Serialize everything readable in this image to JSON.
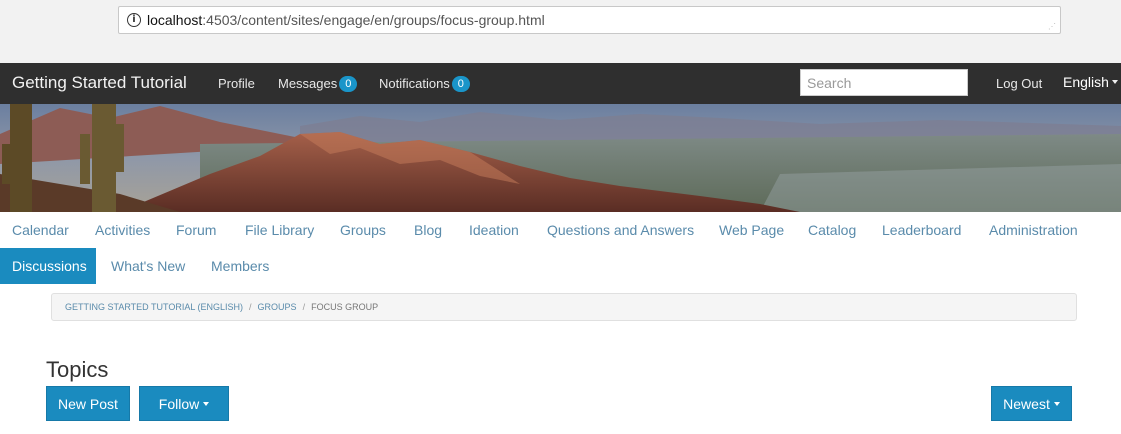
{
  "browser": {
    "url_host": "localhost",
    "url_rest": ":4503/content/sites/engage/en/groups/focus-group.html"
  },
  "navbar": {
    "brand": "Getting Started Tutorial",
    "profile": "Profile",
    "messages": "Messages",
    "messages_count": "0",
    "notifications": "Notifications",
    "notifications_count": "0",
    "search_placeholder": "Search",
    "logout": "Log Out",
    "language": "English"
  },
  "subnav": {
    "row1": [
      "Calendar",
      "Activities",
      "Forum",
      "File Library",
      "Groups",
      "Blog",
      "Ideation",
      "Questions and Answers",
      "Web Page",
      "Catalog",
      "Leaderboard",
      "Administration"
    ],
    "row2": [
      "Discussions",
      "What's New",
      "Members"
    ],
    "active": "Discussions"
  },
  "breadcrumb": {
    "items": [
      "GETTING STARTED TUTORIAL (ENGLISH)",
      "GROUPS",
      "FOCUS GROUP"
    ],
    "separator": "/"
  },
  "topics": {
    "title": "Topics",
    "new_post": "New Post",
    "follow": "Follow",
    "sort": "Newest"
  },
  "colors": {
    "accent": "#1a8bbf",
    "navbar_bg": "#2f2f2f",
    "link": "#5a8bab",
    "badge": "#1a95c9"
  }
}
